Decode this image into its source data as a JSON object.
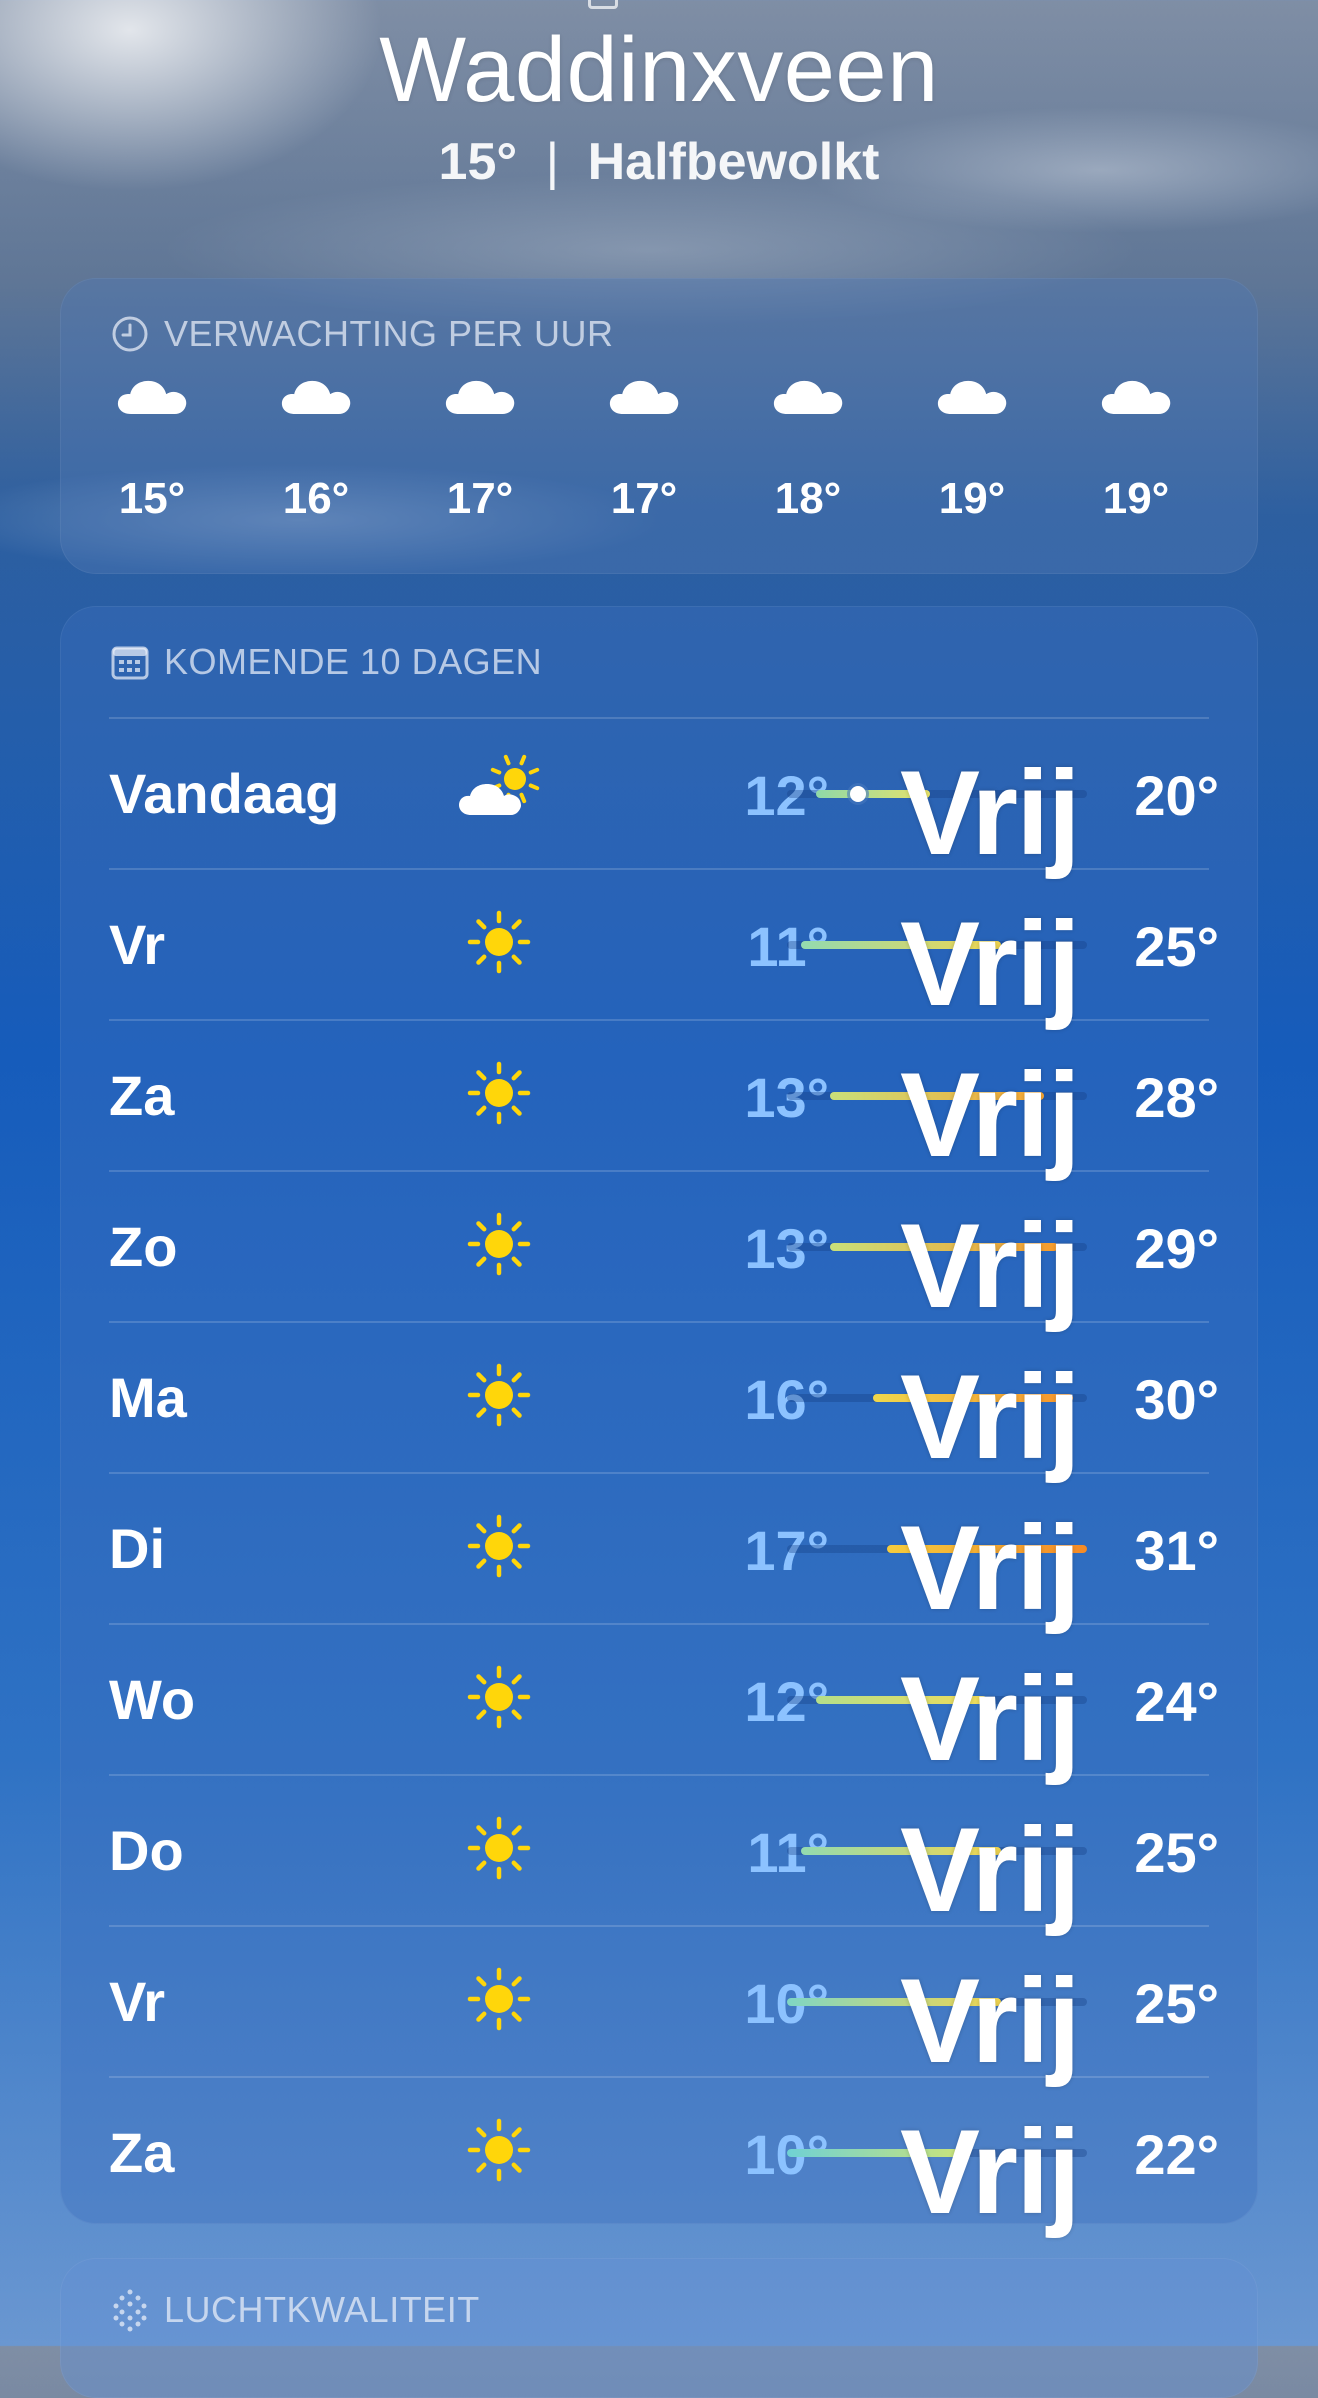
{
  "location": {
    "city": "Waddinxveen",
    "current_temp": "15°",
    "separator": "|",
    "condition": "Halfbewolkt"
  },
  "hourly": {
    "header": "VERWACHTING PER UUR",
    "icon": "clock-icon",
    "items": [
      {
        "icon": "cloud-icon",
        "temp": "15°"
      },
      {
        "icon": "cloud-icon",
        "temp": "16°"
      },
      {
        "icon": "cloud-icon",
        "temp": "17°"
      },
      {
        "icon": "cloud-icon",
        "temp": "17°"
      },
      {
        "icon": "cloud-icon",
        "temp": "18°"
      },
      {
        "icon": "cloud-icon",
        "temp": "19°"
      },
      {
        "icon": "cloud-icon",
        "temp": "19°"
      }
    ]
  },
  "daily": {
    "header": "KOMENDE 10 DAGEN",
    "icon": "calendar-icon",
    "overlay_text": "Vrij",
    "range": {
      "min": 10,
      "max": 31
    },
    "days": [
      {
        "name": "Vandaag",
        "icon": "partly-sunny-icon",
        "low": "12°",
        "high": "20°",
        "low_val": 12,
        "high_val": 20,
        "current": 15,
        "color_start": "#8fd9a8",
        "color_end": "#e8e36a"
      },
      {
        "name": "Vr",
        "icon": "sun-icon",
        "low": "11°",
        "high": "25°",
        "low_val": 11,
        "high_val": 25,
        "color_start": "#93dbb0",
        "color_end": "#f2d64f"
      },
      {
        "name": "Za",
        "icon": "sun-icon",
        "low": "13°",
        "high": "28°",
        "low_val": 13,
        "high_val": 28,
        "color_start": "#c9e07a",
        "color_end": "#f7a531"
      },
      {
        "name": "Zo",
        "icon": "sun-icon",
        "low": "13°",
        "high": "29°",
        "low_val": 13,
        "high_val": 29,
        "color_start": "#c9e07a",
        "color_end": "#f79b2c"
      },
      {
        "name": "Ma",
        "icon": "sun-icon",
        "low": "16°",
        "high": "30°",
        "low_val": 16,
        "high_val": 30,
        "color_start": "#f0d84c",
        "color_end": "#f7932a"
      },
      {
        "name": "Di",
        "icon": "sun-icon",
        "low": "17°",
        "high": "31°",
        "low_val": 17,
        "high_val": 31,
        "color_start": "#f5cc3e",
        "color_end": "#f58a26"
      },
      {
        "name": "Wo",
        "icon": "sun-icon",
        "low": "12°",
        "high": "24°",
        "low_val": 12,
        "high_val": 24,
        "color_start": "#b5df8a",
        "color_end": "#f0dc5a"
      },
      {
        "name": "Do",
        "icon": "sun-icon",
        "low": "11°",
        "high": "25°",
        "low_val": 11,
        "high_val": 25,
        "color_start": "#93dbb0",
        "color_end": "#f2d64f"
      },
      {
        "name": "Vr",
        "icon": "sun-icon",
        "low": "10°",
        "high": "25°",
        "low_val": 10,
        "high_val": 25,
        "color_start": "#7fd6c4",
        "color_end": "#f2d64f"
      },
      {
        "name": "Za",
        "icon": "sun-icon",
        "low": "10°",
        "high": "22°",
        "low_val": 10,
        "high_val": 22,
        "color_start": "#6fd1d4",
        "color_end": "#c7e37c"
      }
    ]
  },
  "air_quality": {
    "header": "LUCHTKWALITEIT",
    "icon": "air-quality-icon"
  }
}
